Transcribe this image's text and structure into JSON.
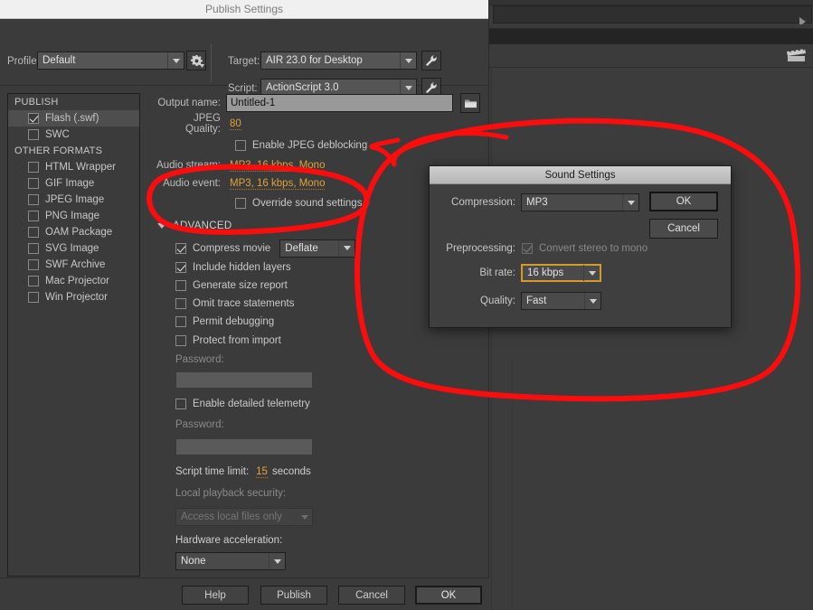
{
  "window": {
    "title": "Publish Settings"
  },
  "top": {
    "profile_label": "Profile:",
    "profile_value": "Default",
    "target_label": "Target:",
    "target_value": "AIR 23.0 for Desktop",
    "script_label": "Script:",
    "script_value": "ActionScript 3.0",
    "gear_icon": "gear-icon",
    "wrench_icon": "wrench-icon"
  },
  "sidebar": {
    "groups": [
      {
        "title": "PUBLISH",
        "items": [
          {
            "label": "Flash (.swf)",
            "checked": true,
            "selected": true
          },
          {
            "label": "SWC",
            "checked": false,
            "selected": false
          }
        ]
      },
      {
        "title": "OTHER FORMATS",
        "items": [
          {
            "label": "HTML Wrapper",
            "checked": false,
            "selected": false
          },
          {
            "label": "GIF Image",
            "checked": false,
            "selected": false
          },
          {
            "label": "JPEG Image",
            "checked": false,
            "selected": false
          },
          {
            "label": "PNG Image",
            "checked": false,
            "selected": false
          },
          {
            "label": "OAM Package",
            "checked": false,
            "selected": false
          },
          {
            "label": "SVG Image",
            "checked": false,
            "selected": false
          },
          {
            "label": "SWF Archive",
            "checked": false,
            "selected": false
          },
          {
            "label": "Mac Projector",
            "checked": false,
            "selected": false
          },
          {
            "label": "Win Projector",
            "checked": false,
            "selected": false
          }
        ]
      }
    ]
  },
  "settings": {
    "output_name_label": "Output name:",
    "output_name_value": "Untitled-1",
    "browse_icon": "folder-icon",
    "jpeg_quality_label": "JPEG Quality:",
    "jpeg_quality_value": "80",
    "jpeg_deblocking_label": "Enable JPEG deblocking",
    "jpeg_deblocking_checked": false,
    "audio_stream_label": "Audio stream:",
    "audio_stream_value": "MP3, 16 kbps, Mono",
    "audio_event_label": "Audio event:",
    "audio_event_value": "MP3, 16 kbps, Mono",
    "override_sound_label": "Override sound settings",
    "override_sound_checked": false,
    "advanced_label": "ADVANCED",
    "advanced_expanded": true,
    "compress_movie_label": "Compress movie",
    "compress_movie_checked": true,
    "compress_movie_value": "Deflate",
    "include_hidden_layers_label": "Include hidden layers",
    "include_hidden_layers_checked": true,
    "generate_size_report_label": "Generate size report",
    "generate_size_report_checked": false,
    "omit_trace_label": "Omit trace statements",
    "omit_trace_checked": false,
    "permit_debugging_label": "Permit debugging",
    "permit_debugging_checked": false,
    "protect_import_label": "Protect from import",
    "protect_import_checked": false,
    "password_label_1": "Password:",
    "password_value_1": "",
    "telemetry_label": "Enable detailed telemetry",
    "telemetry_checked": false,
    "password_label_2": "Password:",
    "password_value_2": "",
    "script_time_limit_label": "Script time limit:",
    "script_time_limit_value": "15",
    "script_time_limit_unit": "seconds",
    "local_playback_label": "Local playback security:",
    "local_playback_value": "Access local files only",
    "hardware_accel_label": "Hardware acceleration:",
    "hardware_accel_value": "None"
  },
  "footer": {
    "help": "Help",
    "publish": "Publish",
    "cancel": "Cancel",
    "ok": "OK"
  },
  "sound_dialog": {
    "title": "Sound Settings",
    "compression_label": "Compression:",
    "compression_value": "MP3",
    "preprocessing_label": "Preprocessing:",
    "preprocessing_checkbox_label": "Convert stereo to mono",
    "preprocessing_checked": true,
    "bit_rate_label": "Bit rate:",
    "bit_rate_value": "16 kbps",
    "quality_label": "Quality:",
    "quality_value": "Fast",
    "ok": "OK",
    "cancel": "Cancel"
  },
  "annotation": {
    "color": "#fc0d0d",
    "shapes": "two hand-drawn red ellipses highlighting the audio settings rows and the Sound Settings dialog"
  },
  "colors": {
    "accent_orange": "#e0a23a",
    "focus_border": "#d79a28",
    "panel_bg": "#3b3b3b",
    "annotation_red": "#fc0d0d"
  }
}
